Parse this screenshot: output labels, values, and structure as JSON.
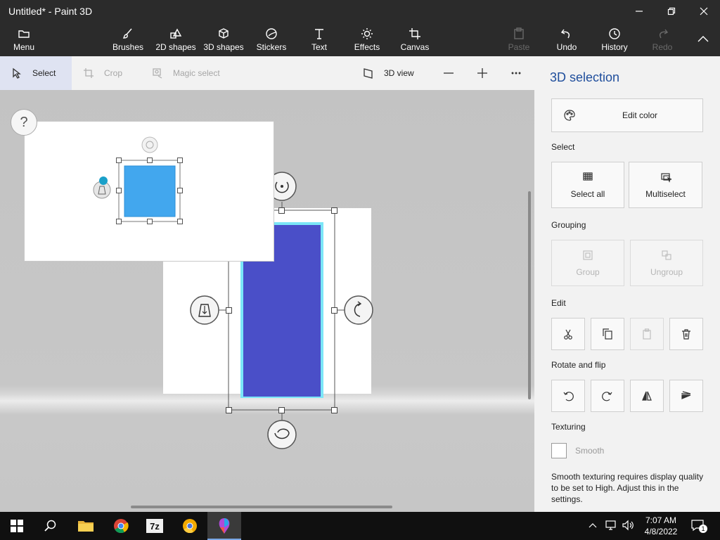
{
  "window": {
    "title": "Untitled* - Paint 3D"
  },
  "ribbon": {
    "menu": "Menu",
    "brushes": "Brushes",
    "shapes2d": "2D shapes",
    "shapes3d": "3D shapes",
    "stickers": "Stickers",
    "text": "Text",
    "effects": "Effects",
    "canvas": "Canvas",
    "paste": "Paste",
    "undo": "Undo",
    "history": "History",
    "redo": "Redo"
  },
  "toolbar": {
    "select": "Select",
    "crop": "Crop",
    "magic_select": "Magic select",
    "view3d": "3D view"
  },
  "canvas": {
    "help": "?",
    "shape_color": "#4a4fc8",
    "shape_glow": "#7be6f7",
    "preview_color": "#42a7ee"
  },
  "panel": {
    "title": "3D selection",
    "edit_color": "Edit color",
    "select_heading": "Select",
    "select_all": "Select all",
    "multiselect": "Multiselect",
    "grouping_heading": "Grouping",
    "group": "Group",
    "ungroup": "Ungroup",
    "edit_heading": "Edit",
    "rotate_heading": "Rotate and flip",
    "texturing_heading": "Texturing",
    "smooth": "Smooth",
    "smooth_help": "Smooth texturing requires display quality to be set to High. Adjust this in the settings."
  },
  "taskbar": {
    "time": "7:07 AM",
    "date": "4/8/2022",
    "notification_count": "1",
    "app_7z": "7z"
  }
}
